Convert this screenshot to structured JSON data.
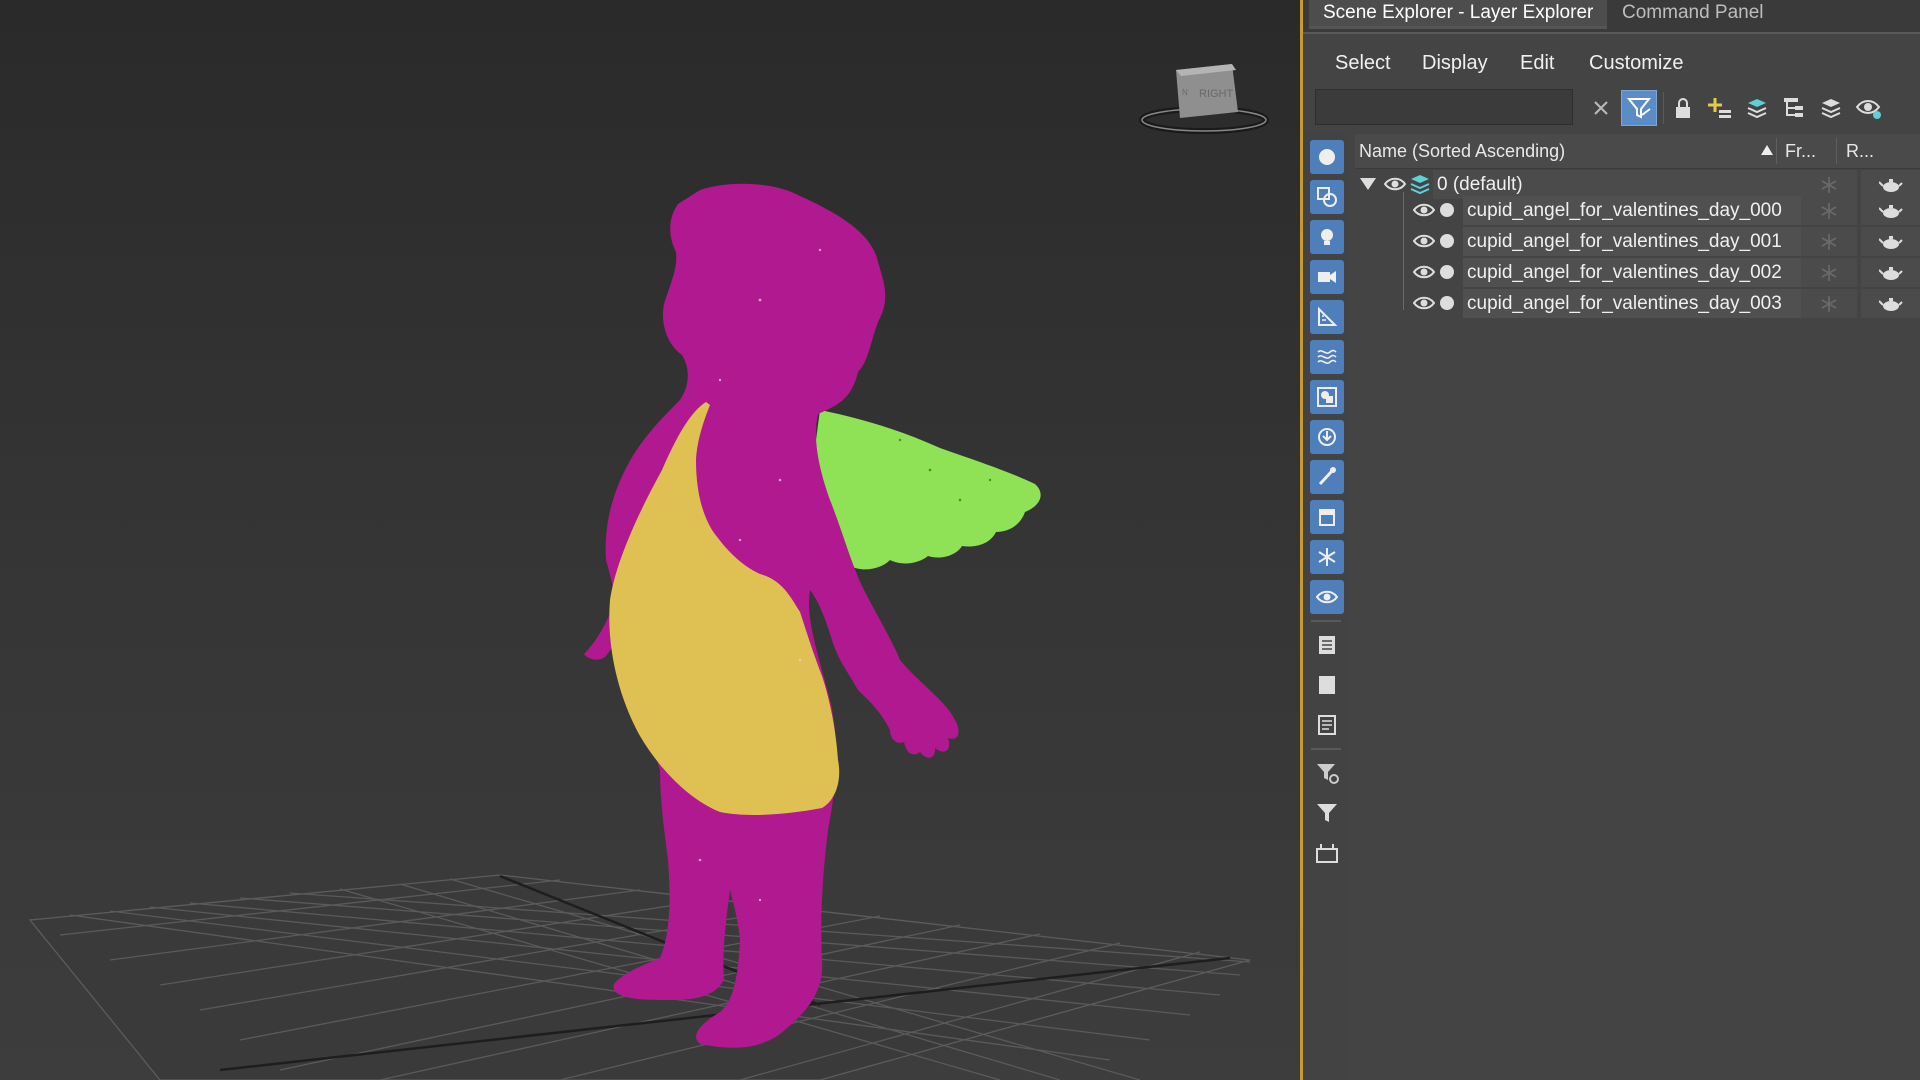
{
  "panel": {
    "tabs": [
      {
        "label": "Scene Explorer - Layer Explorer",
        "active": true
      },
      {
        "label": "Command Panel",
        "active": false
      }
    ],
    "menu": [
      "Select",
      "Display",
      "Edit",
      "Customize"
    ],
    "search": {
      "value": "",
      "placeholder": ""
    },
    "columns": {
      "name": "Name (Sorted Ascending)",
      "frozen": "Fr...",
      "render": "R..."
    },
    "layer": {
      "name": "0 (default)",
      "expanded": true
    },
    "objects": [
      {
        "name": "cupid_angel_for_valentines_day_000"
      },
      {
        "name": "cupid_angel_for_valentines_day_001"
      },
      {
        "name": "cupid_angel_for_valentines_day_002"
      },
      {
        "name": "cupid_angel_for_valentines_day_003"
      }
    ]
  },
  "viewport": {
    "viewcube_label": "RIGHT",
    "viewcube_side_label": "N",
    "colors": {
      "body": "#b0198f",
      "cloth": "#dfc153",
      "wing": "#8fe155",
      "accent_border": "#c69a2d"
    }
  },
  "icons": {
    "toolbar": [
      "clear-icon",
      "filter-icon",
      "lock-icon",
      "add-layer-icon",
      "layers-icon",
      "hierarchy-icon",
      "stack-icon",
      "visibility-settings-icon"
    ],
    "sidebar": [
      "geometry-icon",
      "shapes-icon",
      "lights-icon",
      "cameras-icon",
      "helpers-icon",
      "spacewarps-icon",
      "groups-icon",
      "xrefs-icon",
      "bones-icon",
      "containers-icon",
      "frozen-icon",
      "hidden-icon",
      "select-all-icon",
      "select-none-icon",
      "invert-icon",
      "filter-options-icon",
      "filter-icon",
      "container-icon"
    ]
  }
}
